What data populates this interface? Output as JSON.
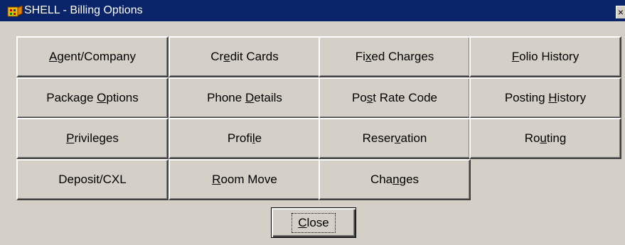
{
  "window": {
    "title": "SHELL - Billing Options",
    "close_glyph": "×",
    "app_icon": "hotel-app-icon"
  },
  "buttons": [
    {
      "id": "agent-company",
      "pre": "",
      "u": "A",
      "post": "gent/Company"
    },
    {
      "id": "credit-cards",
      "pre": "Cr",
      "u": "e",
      "post": "dit Cards"
    },
    {
      "id": "fixed-charges",
      "pre": "Fi",
      "u": "x",
      "post": "ed Charges"
    },
    {
      "id": "folio-history",
      "pre": "",
      "u": "F",
      "post": "olio History"
    },
    {
      "id": "package-options",
      "pre": "Package ",
      "u": "O",
      "post": "ptions"
    },
    {
      "id": "phone-details",
      "pre": "Phone ",
      "u": "D",
      "post": "etails"
    },
    {
      "id": "post-rate-code",
      "pre": "Po",
      "u": "s",
      "post": "t Rate Code"
    },
    {
      "id": "posting-history",
      "pre": "Posting ",
      "u": "H",
      "post": "istory"
    },
    {
      "id": "privileges",
      "pre": "",
      "u": "P",
      "post": "rivileges"
    },
    {
      "id": "profile",
      "pre": "Profi",
      "u": "l",
      "post": "e"
    },
    {
      "id": "reservation",
      "pre": "Reser",
      "u": "v",
      "post": "ation"
    },
    {
      "id": "routing",
      "pre": "Ro",
      "u": "u",
      "post": "ting"
    },
    {
      "id": "deposit-cxl",
      "pre": "Deposit/CXL",
      "u": "",
      "post": ""
    },
    {
      "id": "room-move",
      "pre": "",
      "u": "R",
      "post": "oom Move"
    },
    {
      "id": "changes",
      "pre": "Cha",
      "u": "n",
      "post": "ges"
    }
  ],
  "close_button": {
    "pre": "",
    "u": "C",
    "post": "lose"
  }
}
